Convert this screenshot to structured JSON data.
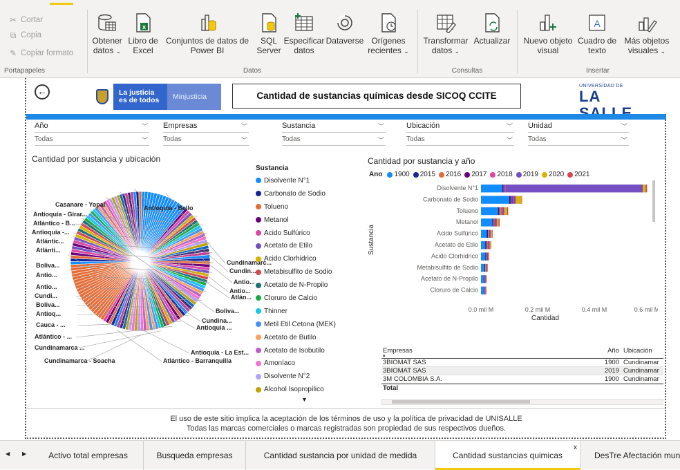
{
  "ribbon": {
    "clipboard": {
      "cut": "Cortar",
      "copy": "Copia",
      "format_painter": "Copiar formato",
      "group_label": "Portapapeles"
    },
    "data": {
      "group_label": "Datos",
      "buttons": [
        {
          "line1": "Obtener",
          "line2": "datos",
          "caret": true
        },
        {
          "line1": "Libro de",
          "line2": "Excel",
          "caret": false
        },
        {
          "line1": "Conjuntos de datos de",
          "line2": "Power BI",
          "caret": false
        },
        {
          "line1": "SQL",
          "line2": "Server",
          "caret": false
        },
        {
          "line1": "Especificar",
          "line2": "datos",
          "caret": false
        },
        {
          "line1": "Dataverse",
          "line2": "",
          "caret": false
        },
        {
          "line1": "Orígenes",
          "line2": "recientes",
          "caret": true
        }
      ]
    },
    "queries": {
      "group_label": "Consultas",
      "buttons": [
        {
          "line1": "Transformar",
          "line2": "datos",
          "caret": true
        },
        {
          "line1": "Actualizar",
          "line2": "",
          "caret": false
        }
      ]
    },
    "insert": {
      "group_label": "Insertar",
      "buttons": [
        {
          "line1": "Nuevo objeto",
          "line2": "visual",
          "caret": false
        },
        {
          "line1": "Cuadro de",
          "line2": "texto",
          "caret": false
        },
        {
          "line1": "Más objetos",
          "line2": "visuales",
          "caret": true
        }
      ]
    }
  },
  "report": {
    "gov_text_1": "La justicia",
    "gov_text_2": "es de todos",
    "gov_text_3": "Minjusticia",
    "title": "Cantidad de sustancias químicas desde SICOQ CCITE",
    "lasalle_small": "UNIVERSIDAD DE",
    "lasalle_big": "LA SALLE",
    "slicers": [
      {
        "label": "Año",
        "value": "Todas"
      },
      {
        "label": "Empresas",
        "value": "Todas"
      },
      {
        "label": "Sustancia",
        "value": "Todas"
      },
      {
        "label": "Ubicación",
        "value": "Todas"
      },
      {
        "label": "Unidad",
        "value": "Todas"
      }
    ],
    "pie_title": "Cantidad por sustancia y ubicación",
    "legend_title": "Sustancia",
    "legend": [
      {
        "name": "Disolvente N°1",
        "color": "#118dff"
      },
      {
        "name": "Carbonato de Sodio",
        "color": "#12239e"
      },
      {
        "name": "Tolueno",
        "color": "#e66c37"
      },
      {
        "name": "Metanol",
        "color": "#6b007b"
      },
      {
        "name": "Acido Sulfúrico",
        "color": "#e044a7"
      },
      {
        "name": "Acetato de Etilo",
        "color": "#744ec2"
      },
      {
        "name": "Acido Clorhidrico",
        "color": "#d9b300"
      },
      {
        "name": "Metabisulfito de Sodio",
        "color": "#d64550"
      },
      {
        "name": "Acetato de N-Propilo",
        "color": "#197278"
      },
      {
        "name": "Cloruro de Calcio",
        "color": "#1aab40"
      },
      {
        "name": "Thinner",
        "color": "#15c6f4"
      },
      {
        "name": "Metil Etil Cetona (MEK)",
        "color": "#4092ff"
      },
      {
        "name": "Acetato de Butilo",
        "color": "#ffa058"
      },
      {
        "name": "Acetato de Isobutilo",
        "color": "#be5dc9"
      },
      {
        "name": "Amoníaco",
        "color": "#f472d0"
      },
      {
        "name": "Disolvente N°2",
        "color": "#b5a1ff"
      },
      {
        "name": "Alcohol Isopropílico",
        "color": "#c4a200"
      }
    ],
    "pie_labels": [
      {
        "text": "Casanare - Yopal"
      },
      {
        "text": "Antioquia - Girar..."
      },
      {
        "text": "Atlántico - B..."
      },
      {
        "text": "Antioquia -..."
      },
      {
        "text": "Atlántic..."
      },
      {
        "text": "Atlánti..."
      },
      {
        "text": "Boliva..."
      },
      {
        "text": "Antio..."
      },
      {
        "text": "Antio..."
      },
      {
        "text": "Cundi..."
      },
      {
        "text": "Boliva..."
      },
      {
        "text": "Antioq..."
      },
      {
        "text": "Cauca - ..."
      },
      {
        "text": "Atlántico - ..."
      },
      {
        "text": "Cundinamarca ..."
      },
      {
        "text": "Cundinamarca - Soacha"
      },
      {
        "text": "Atlántico - Barranquilla"
      },
      {
        "text": "Antioquia - La Est..."
      },
      {
        "text": "Antioquia ..."
      },
      {
        "text": "Cundina..."
      },
      {
        "text": "Boliva..."
      },
      {
        "text": "Atlán..."
      },
      {
        "text": "Antio..."
      },
      {
        "text": "Antio..."
      },
      {
        "text": "Cundin..."
      },
      {
        "text": "Cundinamarc..."
      },
      {
        "text": "Antioquia - Bello"
      }
    ],
    "bar_title": "Cantidad por sustancia y año",
    "year_legend_title": "Ano",
    "years": [
      {
        "name": "1900",
        "color": "#118dff"
      },
      {
        "name": "2015",
        "color": "#12239e"
      },
      {
        "name": "2016",
        "color": "#e66c37"
      },
      {
        "name": "2017",
        "color": "#6b007b"
      },
      {
        "name": "2018",
        "color": "#e044a7"
      },
      {
        "name": "2019",
        "color": "#744ec2"
      },
      {
        "name": "2020",
        "color": "#d9b300"
      },
      {
        "name": "2021",
        "color": "#d64550"
      }
    ],
    "table": {
      "headers": {
        "c1": "Empresas",
        "c2": "Año",
        "c3": "Ubicación"
      },
      "rows": [
        {
          "c1": "3BIOMAT SAS",
          "c2": "1900",
          "c3": "Cundinamar"
        },
        {
          "c1": "3BIOMAT SAS",
          "c2": "2019",
          "c3": "Cundinamar"
        },
        {
          "c1": "3M COLOMBIA S.A.",
          "c2": "1900",
          "c3": "Cundinamar"
        }
      ],
      "total": "Total"
    },
    "footer_line1": "El uso de este sitio implica la aceptación de los términos de uso y la política de privacidad de UNISALLE",
    "footer_line2": "Todas las marcas comerciales o marcas registradas son propiedad de sus respectivos dueños."
  },
  "chart_data": [
    {
      "type": "pie",
      "title": "Cantidad por sustancia y ubicación",
      "legend_title": "Sustancia",
      "categories": [
        "Cundinamarc...",
        "Antioquia - Bello",
        "Casanare - Yopal",
        "Antioquia - Girar...",
        "Atlántico - B...",
        "Antioquia -...",
        "Atlántic...",
        "Atlánti...",
        "Boliva...",
        "Antio...",
        "Antio...",
        "Cundi...",
        "Boliva...",
        "Antioq...",
        "Cauca - ...",
        "Atlántico - ...",
        "Cundinamarca ...",
        "Cundinamarca - Soacha",
        "Atlántico - Barranquilla",
        "Antioquia - La Est...",
        "Antioquia ...",
        "Cundina...",
        "Boliva...",
        "Atlán...",
        "Antio...",
        "Antio...",
        "Cundin..."
      ],
      "values": [
        10,
        2,
        2,
        2,
        2,
        2,
        2,
        2,
        2,
        2,
        2,
        2,
        2,
        2,
        2,
        2,
        3,
        4,
        7,
        14,
        4,
        4,
        4,
        3,
        3,
        3,
        3
      ]
    },
    {
      "type": "bar",
      "orientation": "horizontal",
      "stacked": true,
      "title": "Cantidad por sustancia y año",
      "xlabel": "Cantidad",
      "ylabel": "Sustancia",
      "xlim": [
        0,
        0.6
      ],
      "x_unit": "mil M",
      "x_ticks": [
        "0.0 mil M",
        "0.2 mil M",
        "0.4 mil M",
        "0.6 mil M"
      ],
      "categories": [
        "Disolvente N°1",
        "Carbonato de Sodio",
        "Tolueno",
        "Metanol",
        "Acido Sulfúrico",
        "Acetato de Etilo",
        "Acido Clorhidrico",
        "Metabisulfito de Sodio",
        "Acetato de N-Propilo",
        "Cloruro de Calcio"
      ],
      "series": [
        {
          "name": "1900",
          "values": [
            0.075,
            0.1,
            0.06,
            0.04,
            0.02,
            0.015,
            0.015,
            0.012,
            0.01,
            0.01
          ]
        },
        {
          "name": "2015",
          "values": [
            0.005,
            0.005,
            0.005,
            0.004,
            0.005,
            0.005,
            0.004,
            0.003,
            0.003,
            0.002
          ]
        },
        {
          "name": "2016",
          "values": [
            0.002,
            0.003,
            0.008,
            0.004,
            0.004,
            0.006,
            0.003,
            0.002,
            0.002,
            0.002
          ]
        },
        {
          "name": "2017",
          "values": [
            0.002,
            0.003,
            0.002,
            0.003,
            0.002,
            0.002,
            0.001,
            0.001,
            0.001,
            0.001
          ]
        },
        {
          "name": "2018",
          "values": [
            0.002,
            0.002,
            0.002,
            0.002,
            0.001,
            0.001,
            0.001,
            0.001,
            0.001,
            0.001
          ]
        },
        {
          "name": "2019",
          "values": [
            0.485,
            0.01,
            0.005,
            0.003,
            0.003,
            0.002,
            0.002,
            0.002,
            0.001,
            0.001
          ]
        },
        {
          "name": "2020",
          "values": [
            0.01,
            0.02,
            0.01,
            0.006,
            0.004,
            0.003,
            0.002,
            0.002,
            0.001,
            0.001
          ]
        },
        {
          "name": "2021",
          "values": [
            0.005,
            0.002,
            0.004,
            0.004,
            0.002,
            0.002,
            0.001,
            0.001,
            0.001,
            0.001
          ]
        }
      ]
    }
  ],
  "page_tabs": [
    {
      "label": "Activo total empresas",
      "active": false
    },
    {
      "label": "Busqueda empresas",
      "active": false
    },
    {
      "label": "Cantidad sustancia por unidad de medida",
      "active": false
    },
    {
      "label": "Cantidad sustancias quimicas",
      "active": true
    },
    {
      "label": "DesTre Afectación mun",
      "active": false
    }
  ],
  "page_tab_close": "x"
}
